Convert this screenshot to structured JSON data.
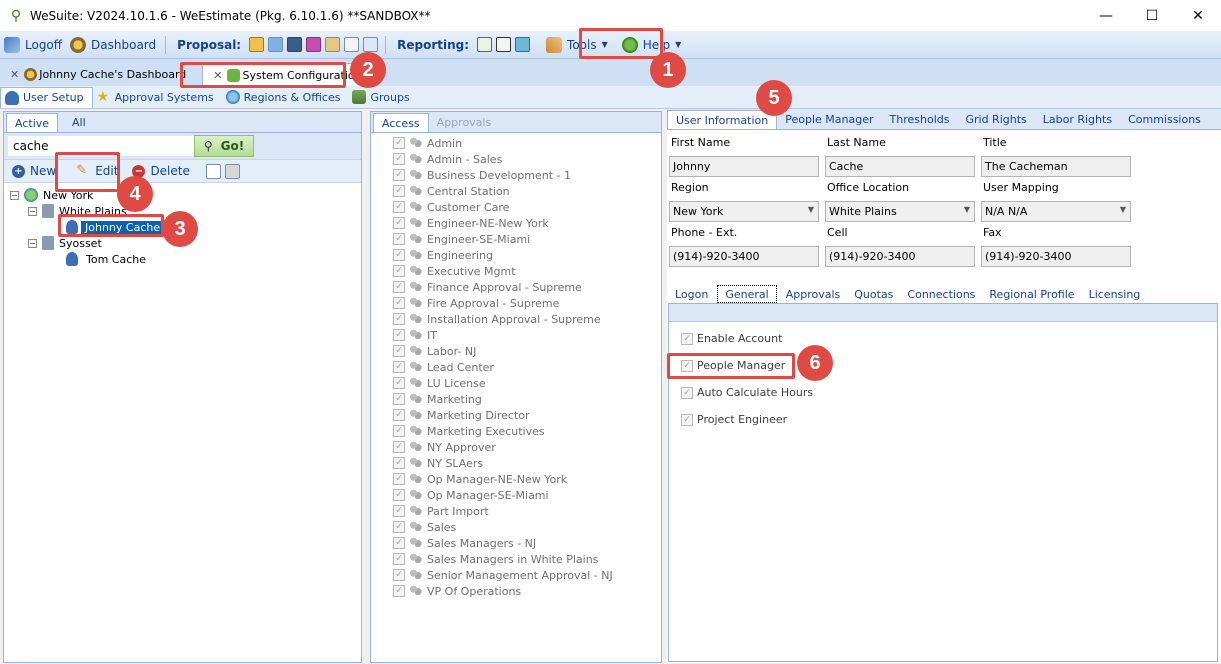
{
  "window": {
    "title": "WeSuite: V2024.10.1.6 - WeEstimate (Pkg. 6.10.1.6) **SANDBOX**",
    "minimize": "—",
    "maximize": "☐",
    "close": "✕"
  },
  "toolbar": {
    "logoff": "Logoff",
    "dashboard": "Dashboard",
    "proposal_label": "Proposal:",
    "reporting_label": "Reporting:",
    "tools": "Tools",
    "help": "Help"
  },
  "doc_tabs": {
    "dashboard": "Johnny Cache's Dashboard",
    "system_config": "System Configuration"
  },
  "sub_tabs": {
    "user_setup": "User Setup",
    "approval_systems": "Approval Systems",
    "regions_offices": "Regions & Offices",
    "groups": "Groups"
  },
  "left": {
    "tab_active": "Active",
    "tab_all": "All",
    "search_value": "cache",
    "go": "Go!",
    "new": "New",
    "edit": "Edit",
    "delete": "Delete",
    "tree": {
      "region": "New York",
      "office1": "White Plains",
      "user1": "Johnny Cache",
      "office2": "Syosset",
      "user2": "Tom Cache"
    }
  },
  "middle": {
    "tab_access": "Access",
    "tab_approvals": "Approvals",
    "items": [
      "Admin",
      "Admin - Sales",
      "Business Development - 1",
      "Central Station",
      "Customer Care",
      "Engineer-NE-New York",
      "Engineer-SE-Miami",
      "Engineering",
      "Executive Mgmt",
      "Finance Approval - Supreme",
      "Fire Approval - Supreme",
      "Installation Approval - Supreme",
      "IT",
      "Labor- NJ",
      "Lead Center",
      "LU License",
      "Marketing",
      "Marketing Director",
      "Marketing Executives",
      "NY Approver",
      "NY SLAers",
      "Op Manager-NE-New York",
      "Op Manager-SE-Miami",
      "Part Import",
      "Sales",
      "Sales Managers - NJ",
      "Sales Managers in White Plains",
      "Senior Management Approval - NJ",
      "VP Of Operations"
    ]
  },
  "right": {
    "tabs": {
      "user_information": "User Information",
      "people_manager": "People Manager",
      "thresholds": "Thresholds",
      "grid_rights": "Grid Rights",
      "labor_rights": "Labor Rights",
      "commissions": "Commissions"
    },
    "labels": {
      "first_name": "First Name",
      "last_name": "Last Name",
      "title": "Title",
      "region": "Region",
      "office_location": "Office Location",
      "user_mapping": "User Mapping",
      "phone": "Phone - Ext.",
      "cell": "Cell",
      "fax": "Fax"
    },
    "values": {
      "first_name": "Johnny",
      "last_name": "Cache",
      "title": "The Cacheman",
      "region": "New York",
      "office_location": "White Plains",
      "user_mapping": "N/A N/A",
      "phone": "(914)-920-3400",
      "cell": "(914)-920-3400",
      "fax": "(914)-920-3400"
    },
    "inner_tabs": {
      "logon": "Logon",
      "general": "General",
      "approvals": "Approvals",
      "quotas": "Quotas",
      "connections": "Connections",
      "regional_profile": "Regional Profile",
      "licensing": "Licensing"
    },
    "checkboxes": {
      "enable_account": "Enable Account",
      "people_manager": "People Manager",
      "auto_calculate_hours": "Auto Calculate Hours",
      "project_engineer": "Project Engineer"
    }
  },
  "annotations": {
    "n1": "1",
    "n2": "2",
    "n3": "3",
    "n4": "4",
    "n5": "5",
    "n6": "6"
  },
  "colors": {
    "highlight": "#e04a44",
    "accent": "#15428b",
    "selection": "#0a64ad"
  }
}
